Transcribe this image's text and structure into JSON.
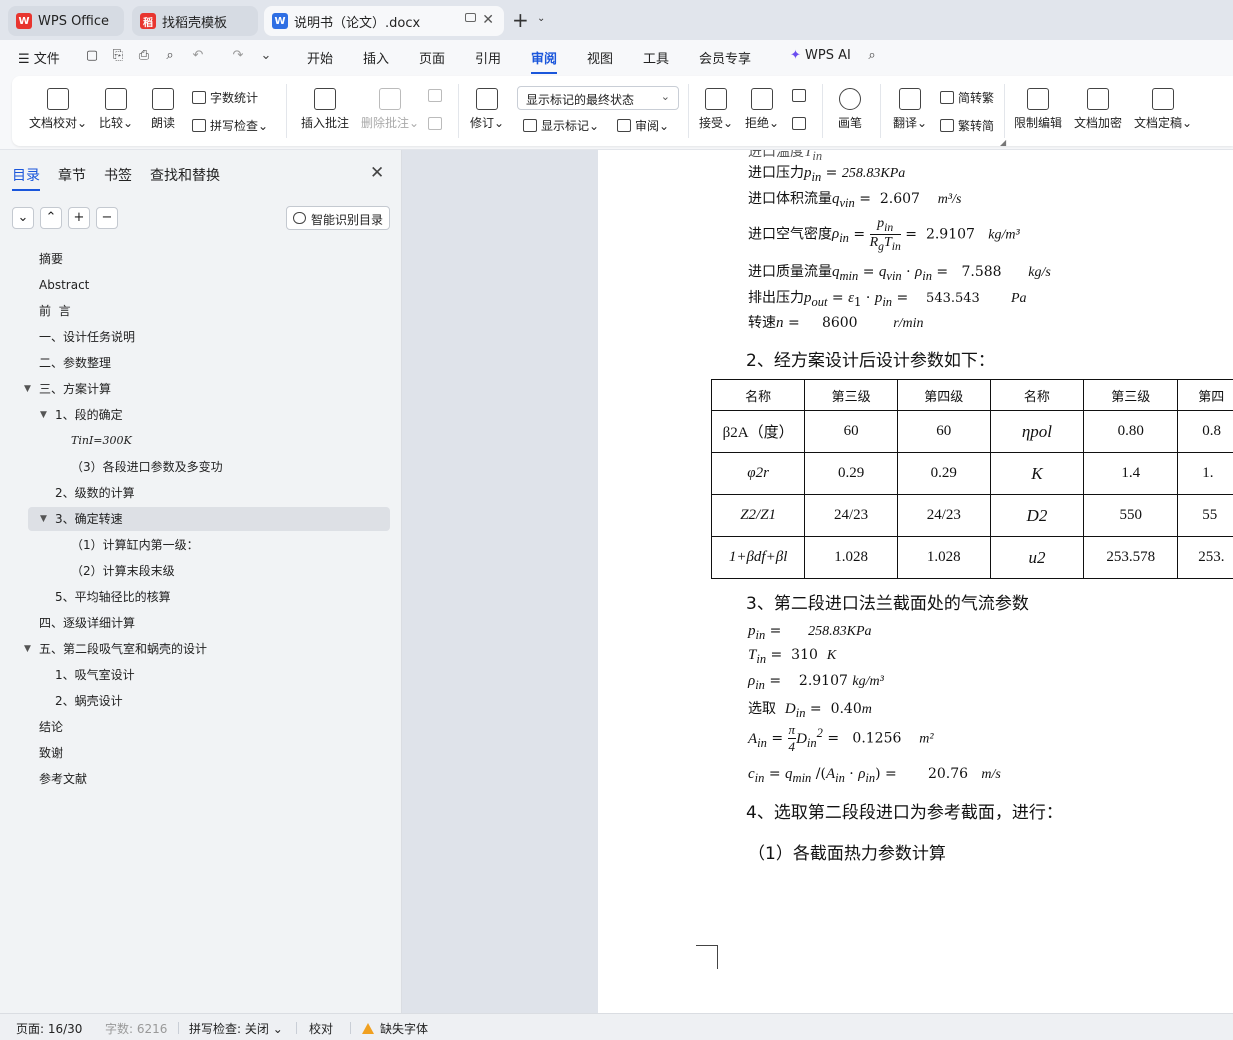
{
  "tabs": [
    {
      "label": "WPS Office"
    },
    {
      "label": "找稻壳模板"
    },
    {
      "label": "说明书（论文）.docx"
    }
  ],
  "menu": {
    "file": "文件",
    "items": [
      "开始",
      "插入",
      "页面",
      "引用",
      "审阅",
      "视图",
      "工具",
      "会员专享"
    ],
    "active": "审阅",
    "ai": "WPS AI"
  },
  "ribbon": {
    "doc_check": "文档校对",
    "compare": "比较",
    "read_aloud": "朗读",
    "word_count": "字数统计",
    "spell_check": "拼写检查",
    "insert_comment": "插入批注",
    "delete_comment": "删除批注",
    "track_changes": "修订",
    "markup_select": "显示标记的最终状态",
    "show_markup": "显示标记",
    "review": "审阅",
    "accept": "接受",
    "reject": "拒绝",
    "pen": "画笔",
    "translate": "翻译",
    "to_traditional": "简转繁",
    "to_simplified": "繁转简",
    "restrict_edit": "限制编辑",
    "encrypt": "文档加密",
    "finalize": "文档定稿"
  },
  "sidebar": {
    "tabs": [
      "目录",
      "章节",
      "书签",
      "查找和替换"
    ],
    "smart_toc": "智能识别目录",
    "toc": [
      {
        "text": "摘要"
      },
      {
        "text": "Abstract"
      },
      {
        "text": "前  言"
      },
      {
        "text": "一、设计任务说明"
      },
      {
        "text": "二、参数整理"
      },
      {
        "text": "三、方案计算"
      },
      {
        "text": "1、段的确定"
      },
      {
        "text": "TinI=300K"
      },
      {
        "text": "（3）各段进口参数及多变功"
      },
      {
        "text": "2、级数的计算"
      },
      {
        "text": "3、确定转速"
      },
      {
        "text": "（1）计算缸内第一级："
      },
      {
        "text": "（2）计算末段末级"
      },
      {
        "text": "5、平均轴径比的核算"
      },
      {
        "text": "四、逐级详细计算"
      },
      {
        "text": "五、第二段吸气室和蜗壳的设计"
      },
      {
        "text": "1、吸气室设计"
      },
      {
        "text": "2、蜗壳设计"
      },
      {
        "text": "结论"
      },
      {
        "text": "致谢"
      },
      {
        "text": "参考文献"
      }
    ]
  },
  "document": {
    "inlet_pressure_label": "进口压力",
    "inlet_pressure_value": "258.83KPa",
    "volume_flow_label": "进口体积流量",
    "volume_flow_value": "2.607",
    "volume_flow_unit": "m³/s",
    "air_density_label": "进口空气密度",
    "air_density_value": "2.9107",
    "air_density_unit": "kg/m³",
    "mass_flow_label": "进口质量流量",
    "mass_flow_value": "7.588",
    "mass_flow_unit": "kg/s",
    "outlet_pressure_label": "排出压力",
    "outlet_pressure_value": "543.543",
    "outlet_pressure_unit": "Pa",
    "speed_label": "转速",
    "speed_value": "8600",
    "speed_unit": "r/min",
    "heading2": "2、经方案设计后设计参数如下：",
    "table": {
      "headers": [
        "名称",
        "第三级",
        "第四级",
        "名称",
        "第三级",
        "第四"
      ],
      "rows": [
        [
          "β2A（度）",
          "60",
          "60",
          "ηpol",
          "0.80",
          "0.8"
        ],
        [
          "φ2r",
          "0.29",
          "0.29",
          "K",
          "1.4",
          "1."
        ],
        [
          "Z2/Z1",
          "24/23",
          "24/23",
          "D2",
          "550",
          "55"
        ],
        [
          "1+βdf+βl",
          "1.028",
          "1.028",
          "u2",
          "253.578",
          "253."
        ]
      ]
    },
    "heading3": "3、第二段进口法兰截面处的气流参数",
    "p_in_value": "258.83KPa",
    "t_in_value": "310",
    "t_in_unit": "K",
    "rho_in_value": "2.9107",
    "rho_in_unit": "kg/m³",
    "select_label": "选取",
    "d_in_value": "0.40",
    "d_in_unit": "m",
    "a_in_value": "0.1256",
    "a_in_unit": "m²",
    "c_in_value": "20.76",
    "c_in_unit": "m/s",
    "heading4": "4、选取第二段段进口为参考截面，进行：",
    "heading5": "（1）各截面热力参数计算"
  },
  "status": {
    "page": "页面: 16/30",
    "words": "字数: 6216",
    "spell": "拼写检查: 关闭",
    "proof": "校对",
    "missing_font": "缺失字体"
  },
  "colors": {
    "accent": "#1a56db",
    "wps_red": "#e8352f",
    "writer_blue": "#2f6fe4"
  }
}
